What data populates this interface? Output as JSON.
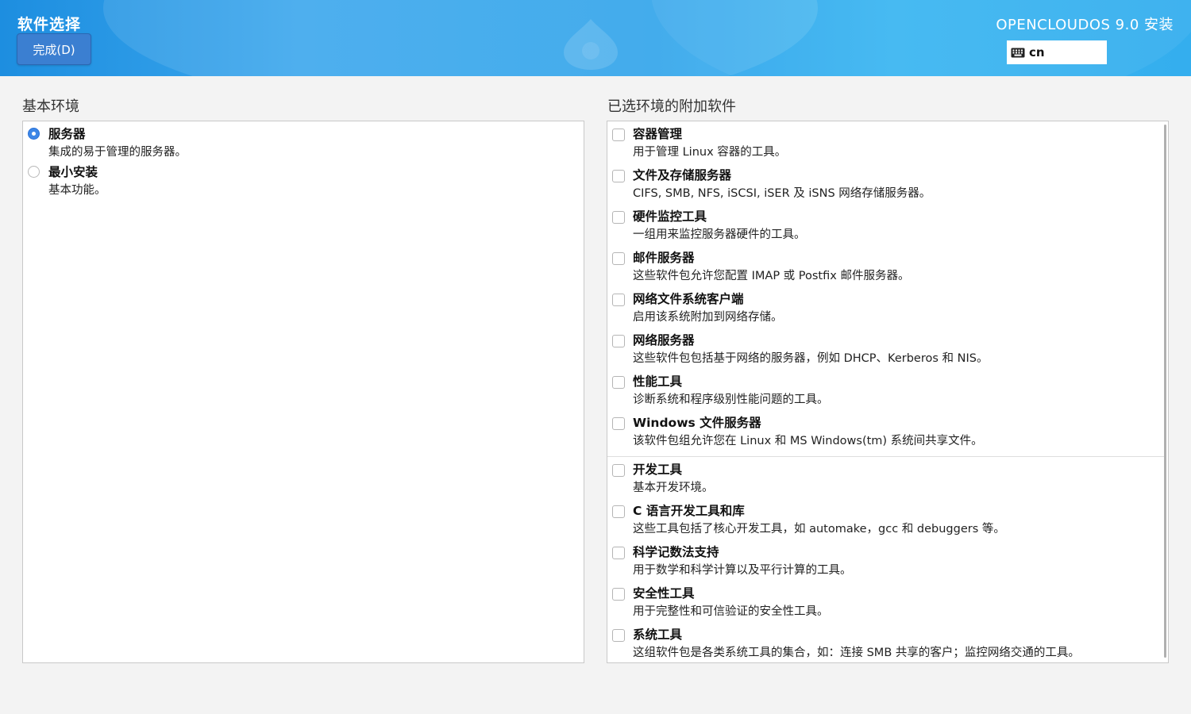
{
  "header": {
    "page_title": "软件选择",
    "done_label": "完成(D)",
    "product_title": "OPENCLOUDOS 9.0 安装",
    "keyboard_layout": "cn"
  },
  "base_env": {
    "label": "基本环境",
    "items": [
      {
        "title": "服务器",
        "desc": "集成的易于管理的服务器。",
        "selected": true
      },
      {
        "title": "最小安装",
        "desc": "基本功能。",
        "selected": false
      }
    ]
  },
  "addons": {
    "label": "已选环境的附加软件",
    "group1": [
      {
        "title": "容器管理",
        "desc": "用于管理 Linux 容器的工具。"
      },
      {
        "title": "文件及存储服务器",
        "desc": "CIFS, SMB, NFS, iSCSI, iSER 及 iSNS 网络存储服务器。"
      },
      {
        "title": "硬件监控工具",
        "desc": "一组用来监控服务器硬件的工具。"
      },
      {
        "title": "邮件服务器",
        "desc": "这些软件包允许您配置 IMAP 或 Postfix 邮件服务器。"
      },
      {
        "title": "网络文件系统客户端",
        "desc": "启用该系统附加到网络存储。"
      },
      {
        "title": "网络服务器",
        "desc": "这些软件包包括基于网络的服务器，例如 DHCP、Kerberos 和 NIS。"
      },
      {
        "title": "性能工具",
        "desc": "诊断系统和程序级别性能问题的工具。"
      },
      {
        "title": "Windows 文件服务器",
        "desc": "该软件包组允许您在 Linux 和 MS Windows(tm) 系统间共享文件。"
      }
    ],
    "group2": [
      {
        "title": "开发工具",
        "desc": "基本开发环境。"
      },
      {
        "title": "C 语言开发工具和库",
        "desc": "这些工具包括了核心开发工具，如 automake，gcc 和 debuggers 等。"
      },
      {
        "title": "科学记数法支持",
        "desc": "用于数学和科学计算以及平行计算的工具。"
      },
      {
        "title": "安全性工具",
        "desc": "用于完整性和可信验证的安全性工具。"
      },
      {
        "title": "系统工具",
        "desc": "这组软件包是各类系统工具的集合，如：连接 SMB 共享的客户；监控网络交通的工具。"
      }
    ]
  },
  "colors": {
    "accent": "#3b7fd1",
    "header": "#2ea3ea"
  }
}
